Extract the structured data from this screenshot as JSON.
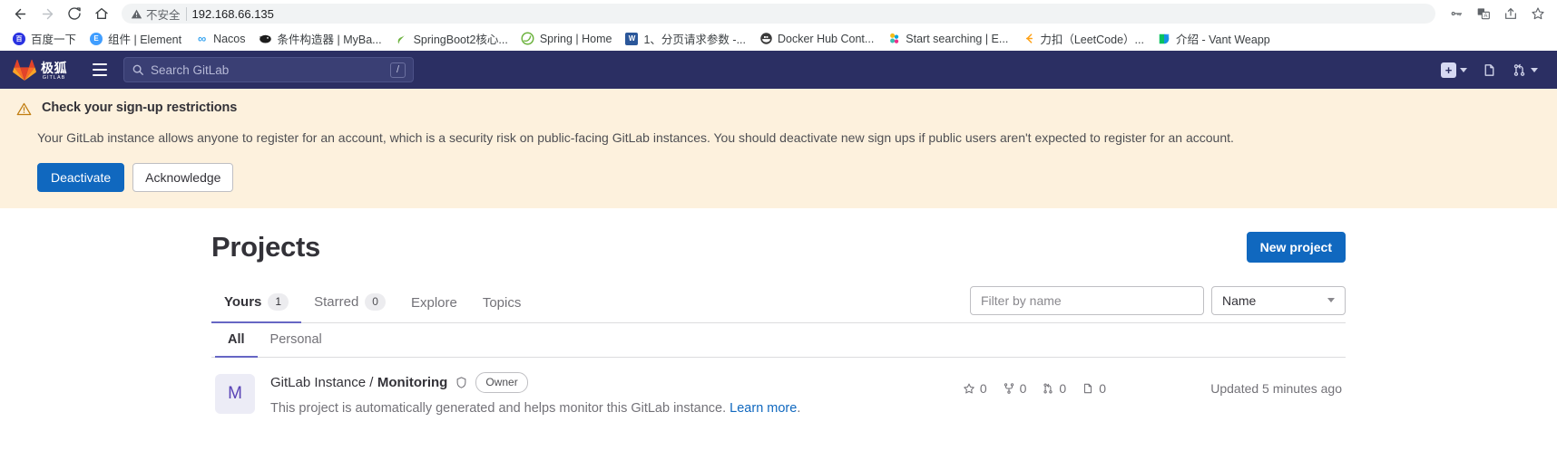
{
  "browser": {
    "nav": {
      "back": "back-arrow",
      "forward": "forward-arrow",
      "reload": "reload-icon",
      "home": "home-icon"
    },
    "omnibox": {
      "security_warning": "不安全",
      "url": "192.168.66.135"
    },
    "toolbar_icons": [
      "key-icon",
      "translate-icon",
      "share-icon",
      "star-icon"
    ],
    "bookmarks": [
      {
        "label": "百度一下",
        "icon": "baidu-favicon",
        "color": "#2932e1",
        "glyph": "百"
      },
      {
        "label": "组件 | Element",
        "icon": "element-favicon",
        "color": "#409eff",
        "glyph": "E"
      },
      {
        "label": "Nacos",
        "icon": "nacos-favicon",
        "color": "#3aa5f0",
        "glyph": "∞"
      },
      {
        "label": "条件构造器 | MyBa...",
        "icon": "mybatis-favicon",
        "color": "#1d1d1d",
        "glyph": "M"
      },
      {
        "label": "SpringBoot2核心...",
        "icon": "springboot-favicon",
        "color": "#6db33f",
        "glyph": "✦"
      },
      {
        "label": "Spring | Home",
        "icon": "spring-favicon",
        "color": "#6db33f",
        "glyph": "S"
      },
      {
        "label": "1、分页请求参数 -...",
        "icon": "word-doc-favicon",
        "color": "#2b579a",
        "glyph": "W"
      },
      {
        "label": "Docker Hub Cont...",
        "icon": "docker-favicon",
        "color": "#3a3a3a",
        "glyph": "D"
      },
      {
        "label": "Start searching | E...",
        "icon": "elastic-favicon",
        "color": "#f4bd19",
        "glyph": "✱"
      },
      {
        "label": "力扣（LeetCode）...",
        "icon": "leetcode-favicon",
        "color": "#ffa116",
        "glyph": "C"
      },
      {
        "label": "介绍 - Vant Weapp",
        "icon": "vant-favicon",
        "color": "#07c160",
        "glyph": "V"
      }
    ]
  },
  "gitlab_nav": {
    "brand_cn": "极狐",
    "brand_en": "GITLAB",
    "menu_icon": "hamburger-icon",
    "search_placeholder": "Search GitLab",
    "search_shortcut": "/",
    "right_items": [
      {
        "name": "create-new-menu",
        "icon": "plus-square-icon",
        "has_chevron": true
      },
      {
        "name": "issues-link",
        "icon": "issues-icon",
        "has_chevron": false
      },
      {
        "name": "merge-requests-menu",
        "icon": "merge-request-icon",
        "has_chevron": true
      }
    ]
  },
  "alert": {
    "icon": "warning-triangle-icon",
    "title": "Check your sign-up restrictions",
    "body": "Your GitLab instance allows anyone to register for an account, which is a security risk on public-facing GitLab instances. You should deactivate new sign ups if public users aren't expected to register for an account.",
    "primary_label": "Deactivate",
    "secondary_label": "Acknowledge",
    "bg_color": "#fdf1dd",
    "primary_color": "#1068bf"
  },
  "page": {
    "title": "Projects",
    "new_project_label": "New project",
    "tabs": [
      {
        "label": "Yours",
        "badge": "1",
        "active": true
      },
      {
        "label": "Starred",
        "badge": "0",
        "active": false
      },
      {
        "label": "Explore",
        "badge": null,
        "active": false
      },
      {
        "label": "Topics",
        "badge": null,
        "active": false
      }
    ],
    "filter_placeholder": "Filter by name",
    "filter_value": "",
    "sort_value": "Name",
    "subtabs": [
      {
        "label": "All",
        "active": true
      },
      {
        "label": "Personal",
        "active": false
      }
    ],
    "accent_color": "#6666c4"
  },
  "projects": [
    {
      "avatar_letter": "M",
      "namespace": "GitLab Instance /",
      "name": "Monitoring",
      "visibility_icon": "shield-icon",
      "role_badge": "Owner",
      "description": "This project is automatically generated and helps monitor this GitLab instance.",
      "description_link": "Learn more",
      "description_suffix": ".",
      "stars": "0",
      "forks": "0",
      "merge_requests": "0",
      "issues": "0",
      "updated": "Updated 5 minutes ago"
    }
  ]
}
